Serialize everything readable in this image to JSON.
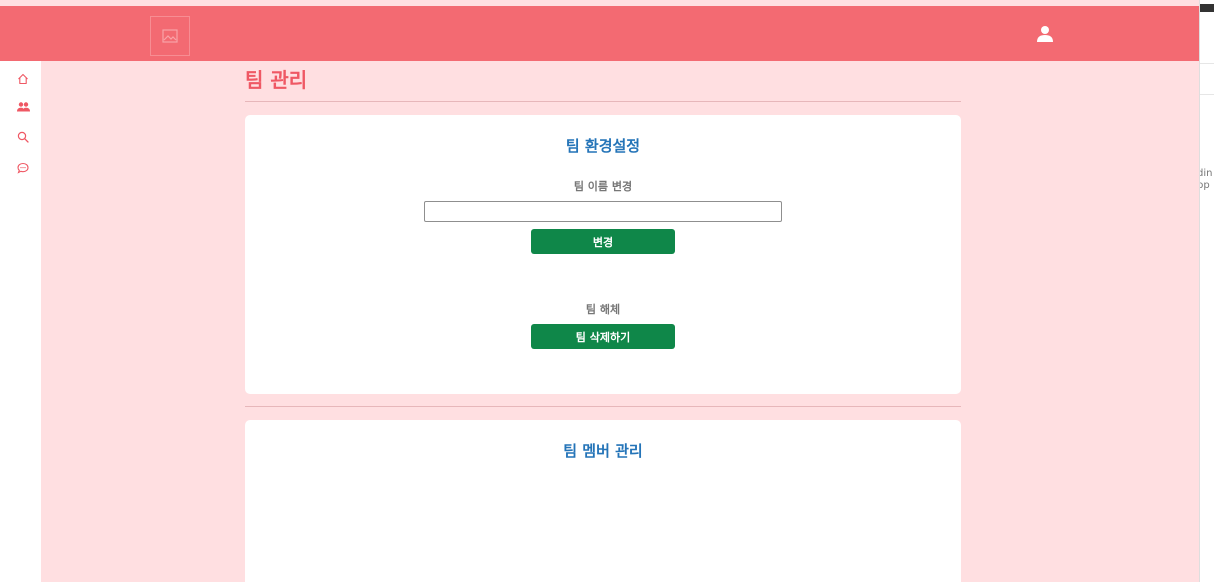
{
  "header": {
    "logo_icon": "broken-image-icon",
    "user_icon": "user-icon"
  },
  "sidebar": {
    "items": [
      {
        "icon": "home-icon",
        "active": false
      },
      {
        "icon": "team-icon",
        "active": true
      },
      {
        "icon": "search-icon",
        "active": false
      },
      {
        "icon": "chat-icon",
        "active": false
      }
    ]
  },
  "page": {
    "title": "팀 관리"
  },
  "settings_card": {
    "title": "팀 환경설정",
    "rename_label": "팀 이름 변경",
    "name_input_value": "",
    "change_button": "변경",
    "disband_label": "팀 해체",
    "delete_button": "팀 삭제하기"
  },
  "members_card": {
    "title": "팀 멤버 관리"
  },
  "right_strip": {
    "line1": "din",
    "line2": "pp"
  },
  "colors": {
    "header": "#f36a72",
    "background": "#ffdfe1",
    "title": "#ef5864",
    "card_title": "#2474b8",
    "button": "#0f8749",
    "icon": "#ef5864"
  }
}
